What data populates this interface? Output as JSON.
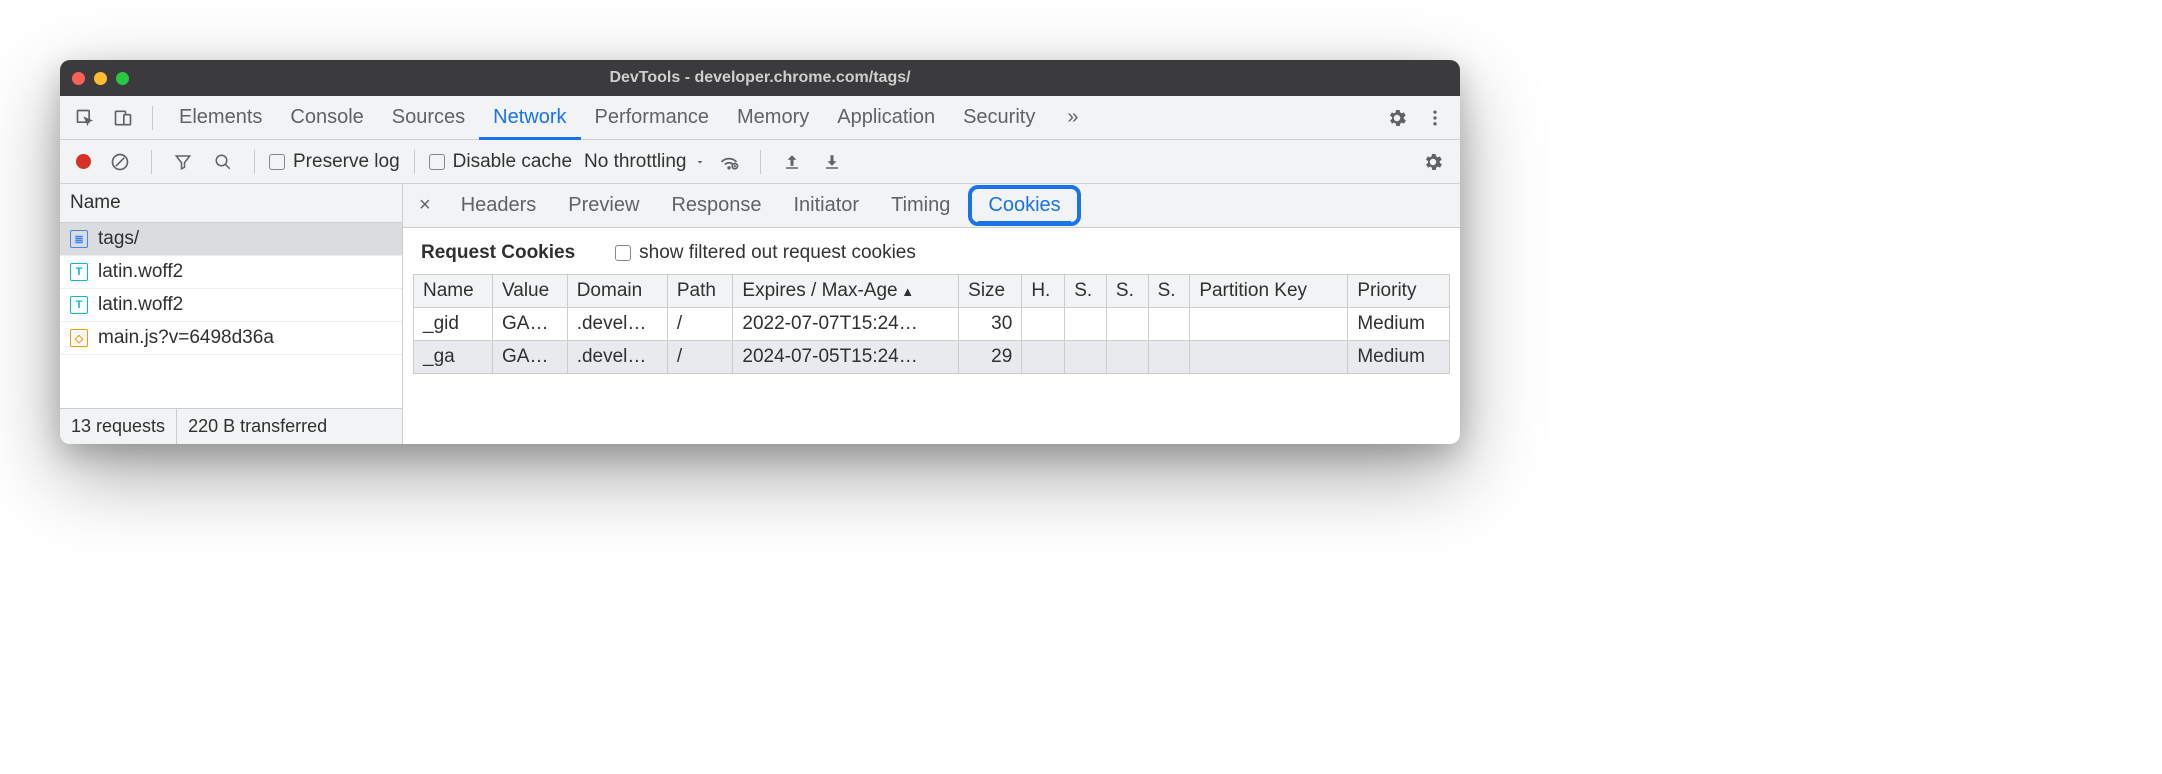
{
  "window_title": "DevTools - developer.chrome.com/tags/",
  "main_tabs": [
    "Elements",
    "Console",
    "Sources",
    "Network",
    "Performance",
    "Memory",
    "Application",
    "Security"
  ],
  "main_tab_selected": "Network",
  "overflow_glyph": "»",
  "toolbar": {
    "preserve_log": "Preserve log",
    "disable_cache": "Disable cache",
    "throttling": "No throttling"
  },
  "left_header": "Name",
  "requests": [
    {
      "name": "tags/",
      "icon": "doc",
      "selected": true
    },
    {
      "name": "latin.woff2",
      "icon": "font"
    },
    {
      "name": "latin.woff2",
      "icon": "font"
    },
    {
      "name": "main.js?v=6498d36a",
      "icon": "js"
    }
  ],
  "status": {
    "requests": "13 requests",
    "transferred": "220 B transferred"
  },
  "detail_tabs": [
    "Headers",
    "Preview",
    "Response",
    "Initiator",
    "Timing",
    "Cookies"
  ],
  "detail_tab_selected": "Cookies",
  "pane": {
    "title": "Request Cookies",
    "filter_checkbox": "show filtered out request cookies"
  },
  "cookie_columns": [
    "Name",
    "Value",
    "Domain",
    "Path",
    "Expires / Max-Age",
    "Size",
    "H.",
    "S.",
    "S.",
    "S.",
    "Partition Key",
    "Priority"
  ],
  "cookies": [
    {
      "name": "_gid",
      "value": "GA…",
      "domain": ".devel…",
      "path": "/",
      "expires": "2022-07-07T15:24…",
      "size": "30",
      "h": "",
      "s1": "",
      "s2": "",
      "s3": "",
      "pk": "",
      "priority": "Medium"
    },
    {
      "name": "_ga",
      "value": "GA…",
      "domain": ".devel…",
      "path": "/",
      "expires": "2024-07-05T15:24…",
      "size": "29",
      "h": "",
      "s1": "",
      "s2": "",
      "s3": "",
      "pk": "",
      "priority": "Medium"
    }
  ]
}
